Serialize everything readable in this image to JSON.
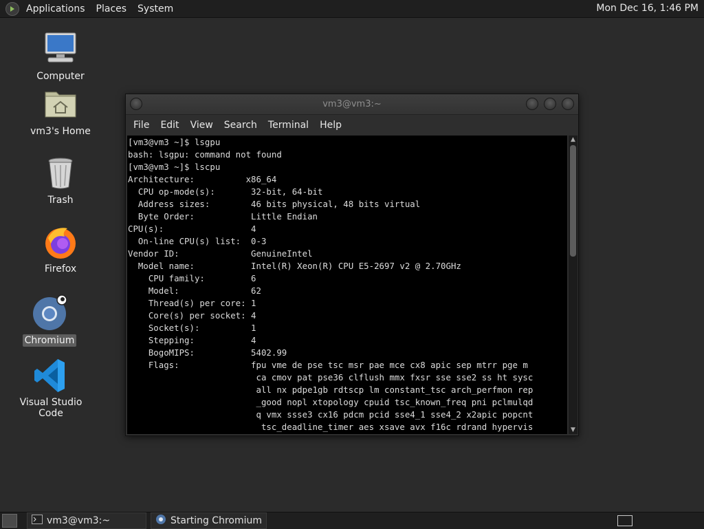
{
  "top_panel": {
    "menus": [
      "Applications",
      "Places",
      "System"
    ],
    "clock": "Mon Dec 16,  1:46 PM"
  },
  "desktop_icons": [
    {
      "label": "Computer",
      "icon": "computer-icon"
    },
    {
      "label": "vm3's Home",
      "icon": "home-folder-icon"
    },
    {
      "label": "Trash",
      "icon": "trash-icon"
    },
    {
      "label": "Firefox",
      "icon": "firefox-icon"
    },
    {
      "label": "Chromium",
      "icon": "chromium-icon",
      "selected": true
    },
    {
      "label": "Visual Studio Code",
      "icon": "vscode-icon"
    }
  ],
  "terminal": {
    "title": "vm3@vm3:~",
    "menus": [
      "File",
      "Edit",
      "View",
      "Search",
      "Terminal",
      "Help"
    ],
    "lines": [
      "[vm3@vm3 ~]$ lsgpu",
      "bash: lsgpu: command not found",
      "[vm3@vm3 ~]$ lscpu",
      "Architecture:          x86_64",
      "  CPU op-mode(s):       32-bit, 64-bit",
      "  Address sizes:        46 bits physical, 48 bits virtual",
      "  Byte Order:           Little Endian",
      "CPU(s):                 4",
      "  On-line CPU(s) list:  0-3",
      "Vendor ID:              GenuineIntel",
      "  Model name:           Intel(R) Xeon(R) CPU E5-2697 v2 @ 2.70GHz",
      "    CPU family:         6",
      "    Model:              62",
      "    Thread(s) per core: 1",
      "    Core(s) per socket: 4",
      "    Socket(s):          1",
      "    Stepping:           4",
      "    BogoMIPS:           5402.99",
      "    Flags:              fpu vme de pse tsc msr pae mce cx8 apic sep mtrr pge m",
      "                         ca cmov pat pse36 clflush mmx fxsr sse sse2 ss ht sysc",
      "                         all nx pdpe1gb rdtscp lm constant_tsc arch_perfmon rep",
      "                         _good nopl xtopology cpuid tsc_known_freq pni pclmulqd",
      "                         q vmx ssse3 cx16 pdcm pcid sse4_1 sse4_2 x2apic popcnt",
      "                          tsc_deadline_timer aes xsave avx f16c rdrand hypervis"
    ]
  },
  "taskbar": {
    "tasks": [
      {
        "label": "vm3@vm3:~",
        "icon": "terminal-icon"
      },
      {
        "label": "Starting Chromium",
        "icon": "chromium-icon"
      }
    ]
  }
}
